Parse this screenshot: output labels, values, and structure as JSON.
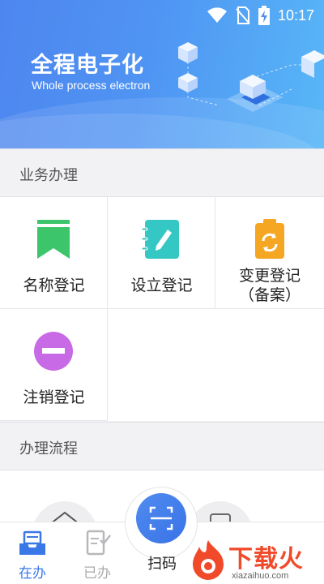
{
  "status_bar": {
    "time": "10:17",
    "icons": [
      "wifi-icon",
      "no-sim-icon",
      "battery-charging-icon"
    ]
  },
  "banner": {
    "title": "全程电子化",
    "subtitle": "Whole process electron"
  },
  "business": {
    "heading": "业务办理",
    "items": [
      {
        "label": "名称登记",
        "icon": "bookmark-icon",
        "color": "#3cc56b"
      },
      {
        "label": "设立登记",
        "icon": "edit-notebook-icon",
        "color": "#35c7c3"
      },
      {
        "label_line1": "变更登记",
        "label_line2": "（备案）",
        "icon": "clipboard-refresh-icon",
        "color": "#f5a623"
      },
      {
        "label": "注销登记",
        "icon": "minus-circle-icon",
        "color": "#c86ae6"
      }
    ]
  },
  "process": {
    "heading": "办理流程"
  },
  "bottom_nav": {
    "items": [
      {
        "label": "在办",
        "icon": "inbox-icon",
        "active": true
      },
      {
        "label": "已办",
        "icon": "done-doc-icon",
        "active": false
      }
    ],
    "scan_label": "扫码",
    "accent": "#3b78e7"
  },
  "watermark": {
    "text": "下载火",
    "sub": "xiazaihuo.com"
  }
}
